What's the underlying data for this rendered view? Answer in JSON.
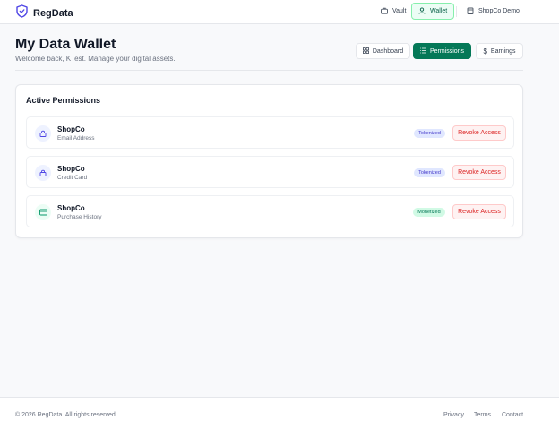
{
  "app": {
    "name": "RegData"
  },
  "nav": {
    "items": [
      {
        "label": "Vault",
        "icon": "briefcase-icon"
      },
      {
        "label": "Wallet",
        "icon": "user-icon",
        "active": true
      },
      {
        "label": "ShopCo Demo",
        "icon": "store-icon"
      }
    ]
  },
  "header": {
    "title": "My Data Wallet",
    "subtitle": "Welcome back, KTest. Manage your digital assets."
  },
  "tabs": [
    {
      "label": "Dashboard",
      "icon": "grid-icon"
    },
    {
      "label": "Permissions",
      "icon": "list-icon",
      "active": true
    },
    {
      "label": "Earnings",
      "icon": "dollar-icon"
    }
  ],
  "permissions": {
    "title": "Active Permissions",
    "revoke_label": "Revoke Access",
    "items": [
      {
        "company": "ShopCo",
        "data_type": "Email Address",
        "status": "Tokenized",
        "icon": "lock-icon"
      },
      {
        "company": "ShopCo",
        "data_type": "Credit Card",
        "status": "Tokenized",
        "icon": "lock-icon"
      },
      {
        "company": "ShopCo",
        "data_type": "Purchase History",
        "status": "Monetized",
        "icon": "credit-card-icon"
      }
    ]
  },
  "footer": {
    "copyright": "© 2026 RegData. All rights reserved.",
    "links": [
      "Privacy",
      "Terms",
      "Contact"
    ]
  },
  "colors": {
    "accent": "#047857",
    "danger": "#dc2626",
    "tokenized_badge": "#e0e7ff",
    "monetized_badge": "#d1fae5"
  }
}
